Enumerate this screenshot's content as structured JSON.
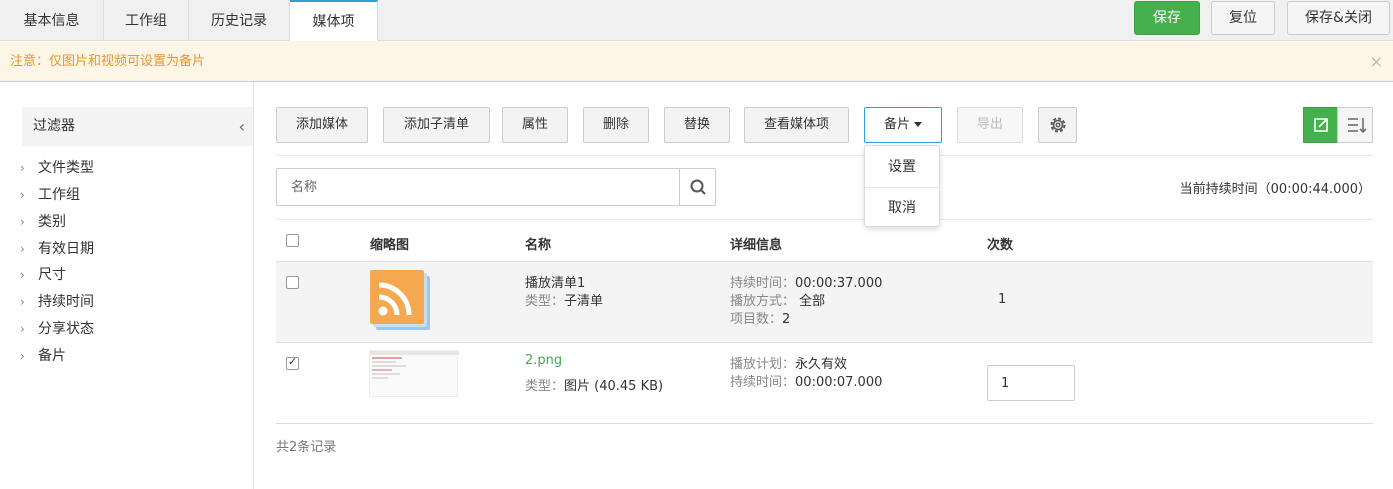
{
  "tabs": [
    {
      "label": "基本信息",
      "active": false
    },
    {
      "label": "工作组",
      "active": false
    },
    {
      "label": "历史记录",
      "active": false
    },
    {
      "label": "媒体项",
      "active": true
    }
  ],
  "top_actions": {
    "save": "保存",
    "reset": "复位",
    "save_close": "保存&关闭"
  },
  "notice": {
    "text": "注意：仅图片和视频可设置为备片",
    "close": "×"
  },
  "filter": {
    "title": "过滤器",
    "items": [
      "文件类型",
      "工作组",
      "类别",
      "有效日期",
      "尺寸",
      "持续时间",
      "分享状态",
      "备片"
    ]
  },
  "toolbar": {
    "add_media": "添加媒体",
    "add_sublist": "添加子清单",
    "properties": "属性",
    "delete": "删除",
    "replace": "替换",
    "view_media": "查看媒体项",
    "backup": "备片",
    "export": "导出"
  },
  "backup_menu": {
    "set": "设置",
    "cancel": "取消"
  },
  "search": {
    "placeholder": "名称"
  },
  "duration_text": "当前持续时间（00:00:44.000）",
  "table": {
    "headers": {
      "thumb": "缩略图",
      "name": "名称",
      "detail": "详细信息",
      "count": "次数"
    },
    "rows": [
      {
        "checked": false,
        "name": "播放清单1",
        "type_label": "类型",
        "type_value": "子清单",
        "details": [
          {
            "label": "持续时间",
            "value": "00:00:37.000"
          },
          {
            "label": "播放方式",
            "value": "全部"
          },
          {
            "label": "项目数",
            "value": "2"
          }
        ],
        "count": "1"
      },
      {
        "checked": true,
        "name": "2.png",
        "type_label": "类型",
        "type_value": "图片 (40.45 KB)",
        "details": [
          {
            "label": "播放计划",
            "value": "永久有效"
          },
          {
            "label": "持续时间",
            "value": "00:00:07.000"
          }
        ],
        "count": "1"
      }
    ]
  },
  "record_count": "共2条记录",
  "colors": {
    "primary": "#44b14c",
    "accent": "#2ea0d8",
    "notice_text": "#e8962c",
    "notice_bg": "#fdf6e6"
  },
  "icons": {
    "search": "search-icon",
    "settings": "gear-icon",
    "view_edit": "edit-icon",
    "view_list": "list-icon",
    "rss": "rss-icon"
  }
}
